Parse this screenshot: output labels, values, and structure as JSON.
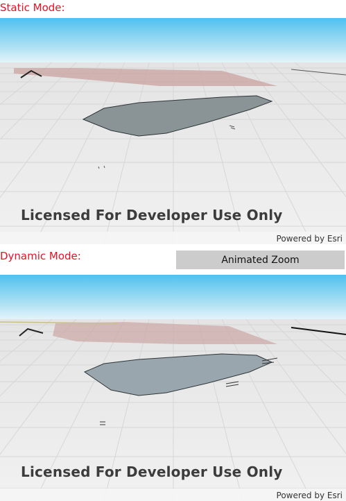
{
  "static_section": {
    "label": "Static Mode:",
    "license_text": "Licensed For Developer Use Only",
    "attribution": "Powered by Esri"
  },
  "dynamic_section": {
    "label": "Dynamic Mode:",
    "zoom_button_label": "Animated Zoom",
    "license_text": "Licensed For Developer Use Only",
    "attribution": "Powered by Esri"
  },
  "colors": {
    "label_red": "#e81123",
    "sky_top": "#4fc1ef",
    "ground": "#ebebeb",
    "pink_polygon": "#c9a3a0",
    "gray_polygon_static": "#8a9396",
    "gray_polygon_dynamic": "#9aa6ad",
    "button_bg": "#cccccc"
  }
}
